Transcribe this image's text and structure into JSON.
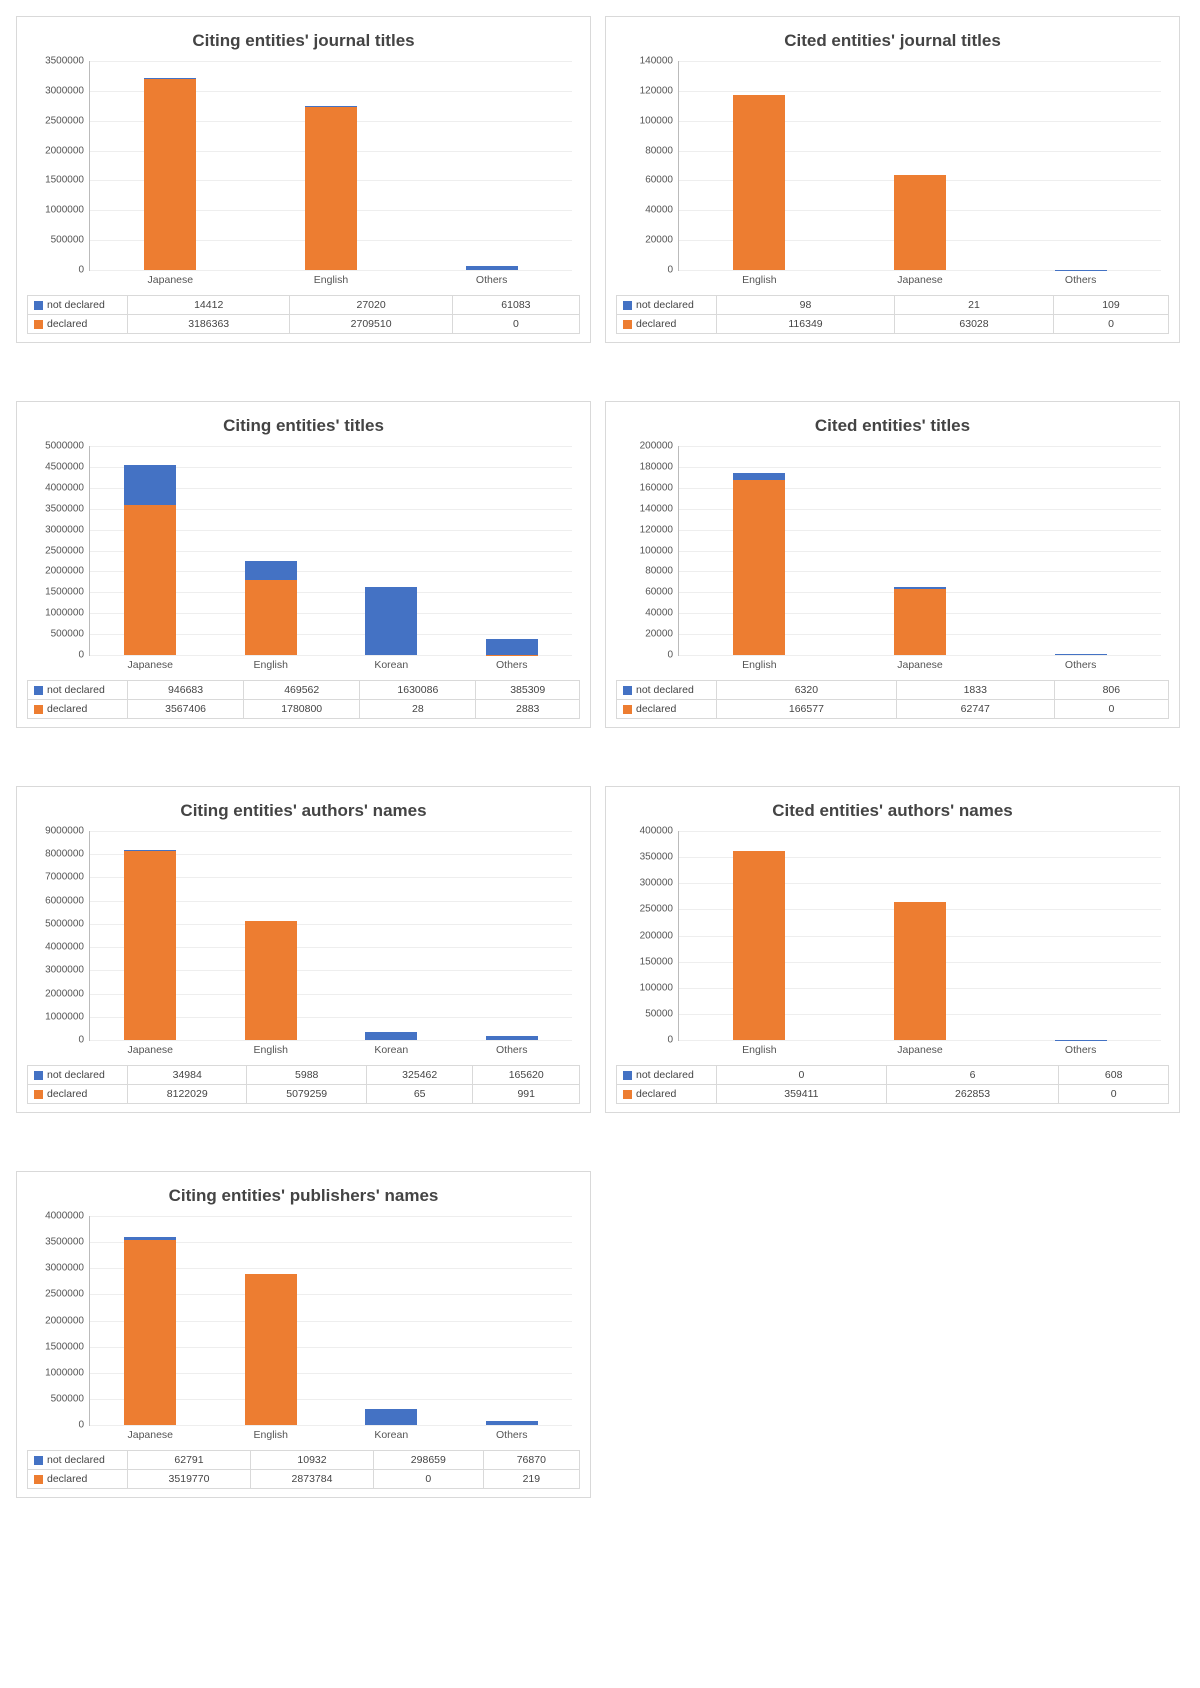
{
  "series_labels": {
    "not_declared": "not declared",
    "declared": "declared"
  },
  "colors": {
    "not_declared": "#4472c4",
    "declared": "#ed7d31"
  },
  "chart_data": [
    {
      "id": "c0",
      "title": "Citing entities' journal titles",
      "type": "bar",
      "stacked": true,
      "categories": [
        "Japanese",
        "English",
        "Others"
      ],
      "series": [
        {
          "name": "not declared",
          "values": [
            14412,
            27020,
            61083
          ]
        },
        {
          "name": "declared",
          "values": [
            3186363,
            2709510,
            0
          ]
        }
      ],
      "ylim": [
        0,
        3500000
      ],
      "ystep": 500000
    },
    {
      "id": "c1",
      "title": "Cited entities' journal titles",
      "type": "bar",
      "stacked": true,
      "categories": [
        "English",
        "Japanese",
        "Others"
      ],
      "series": [
        {
          "name": "not declared",
          "values": [
            98,
            21,
            109
          ]
        },
        {
          "name": "declared",
          "values": [
            116349,
            63028,
            0
          ]
        }
      ],
      "ylim": [
        0,
        140000
      ],
      "ystep": 20000
    },
    {
      "id": "c2",
      "title": "Citing entities' titles",
      "type": "bar",
      "stacked": true,
      "categories": [
        "Japanese",
        "English",
        "Korean",
        "Others"
      ],
      "series": [
        {
          "name": "not declared",
          "values": [
            946683,
            469562,
            1630086,
            385309
          ]
        },
        {
          "name": "declared",
          "values": [
            3567406,
            1780800,
            28,
            2883
          ]
        }
      ],
      "ylim": [
        0,
        5000000
      ],
      "ystep": 500000
    },
    {
      "id": "c3",
      "title": "Cited entities' titles",
      "type": "bar",
      "stacked": true,
      "categories": [
        "English",
        "Japanese",
        "Others"
      ],
      "series": [
        {
          "name": "not declared",
          "values": [
            6320,
            1833,
            806
          ]
        },
        {
          "name": "declared",
          "values": [
            166577,
            62747,
            0
          ]
        }
      ],
      "ylim": [
        0,
        200000
      ],
      "ystep": 20000
    },
    {
      "id": "c4",
      "title": "Citing entities' authors' names",
      "type": "bar",
      "stacked": true,
      "categories": [
        "Japanese",
        "English",
        "Korean",
        "Others"
      ],
      "series": [
        {
          "name": "not declared",
          "values": [
            34984,
            5988,
            325462,
            165620
          ]
        },
        {
          "name": "declared",
          "values": [
            8122029,
            5079259,
            65,
            991
          ]
        }
      ],
      "ylim": [
        0,
        9000000
      ],
      "ystep": 1000000
    },
    {
      "id": "c5",
      "title": "Cited entities' authors' names",
      "type": "bar",
      "stacked": true,
      "categories": [
        "English",
        "Japanese",
        "Others"
      ],
      "series": [
        {
          "name": "not declared",
          "values": [
            0,
            6,
            608
          ]
        },
        {
          "name": "declared",
          "values": [
            359411,
            262853,
            0
          ]
        }
      ],
      "ylim": [
        0,
        400000
      ],
      "ystep": 50000
    },
    {
      "id": "c6",
      "title": "Citing entities' publishers' names",
      "type": "bar",
      "stacked": true,
      "categories": [
        "Japanese",
        "English",
        "Korean",
        "Others"
      ],
      "series": [
        {
          "name": "not declared",
          "values": [
            62791,
            10932,
            298659,
            76870
          ]
        },
        {
          "name": "declared",
          "values": [
            3519770,
            2873784,
            0,
            219
          ]
        }
      ],
      "ylim": [
        0,
        4000000
      ],
      "ystep": 500000
    }
  ]
}
